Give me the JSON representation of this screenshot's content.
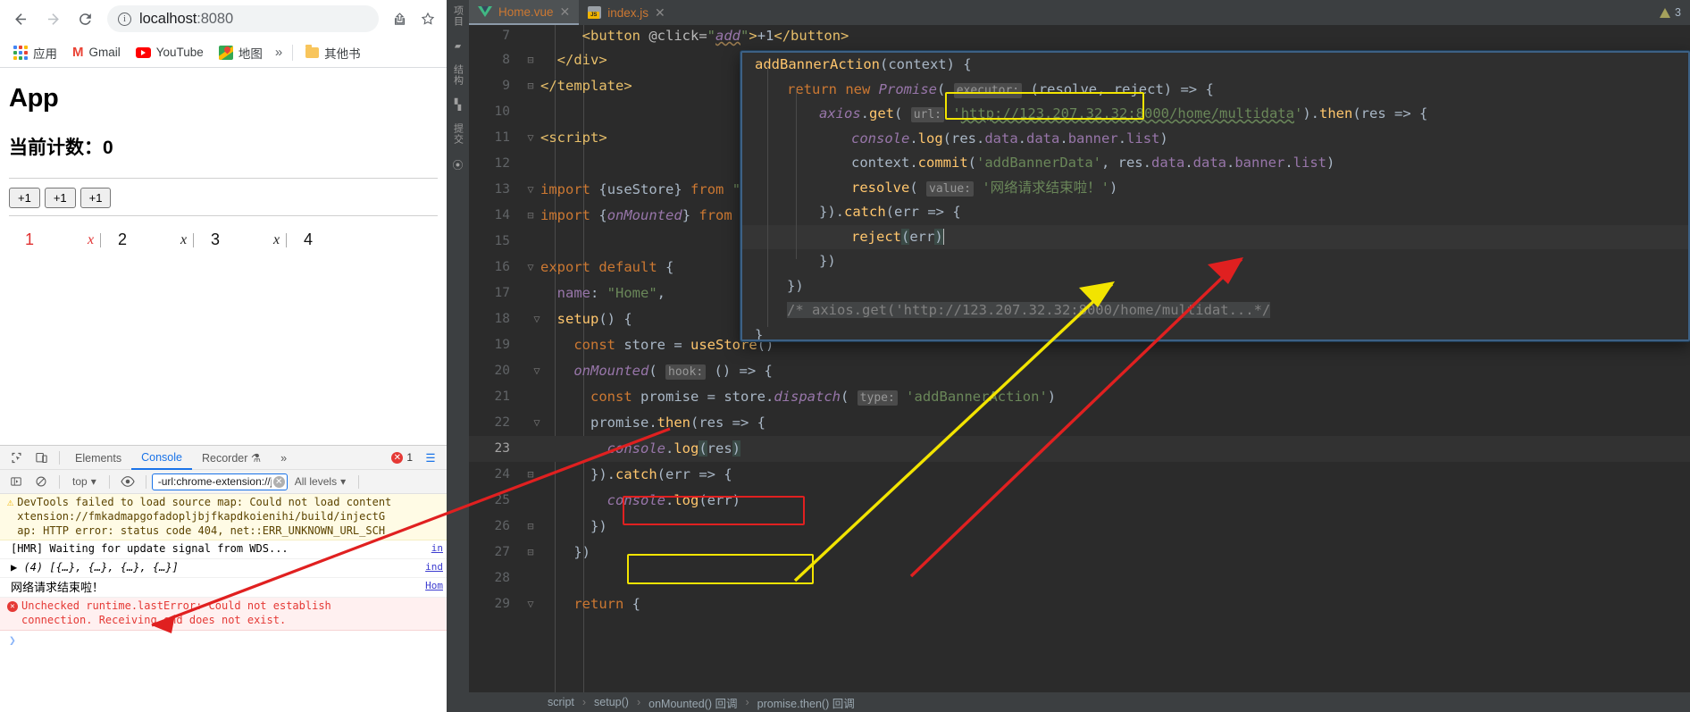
{
  "browser": {
    "nav": {
      "back": "←",
      "forward": "→",
      "reload": "⟳"
    },
    "omnibox": {
      "info_icon": "i",
      "url_host": "localhost",
      "url_port": ":8080",
      "share_icon": "share-icon",
      "star_icon": "★"
    },
    "bookmarks": [
      {
        "label": "应用",
        "icon": "apps-grid-icon"
      },
      {
        "label": "Gmail",
        "icon": "gmail-icon"
      },
      {
        "label": "YouTube",
        "icon": "youtube-icon"
      },
      {
        "label": "地图",
        "icon": "maps-icon"
      },
      {
        "label": "»",
        "icon": "overflow-icon"
      },
      {
        "label": "其他书",
        "icon": "folder-icon"
      }
    ],
    "page": {
      "title": "App",
      "counter_label": "当前计数：0",
      "buttons": [
        "+1",
        "+1",
        "+1"
      ],
      "numbers": [
        "1",
        "2",
        "3",
        "4"
      ],
      "x_label": "x"
    }
  },
  "devtools": {
    "tabs": [
      {
        "label": "Elements",
        "active": false
      },
      {
        "label": "Console",
        "active": true
      },
      {
        "label": "Recorder",
        "active": false,
        "suffix": "⚗"
      },
      {
        "label": "»",
        "active": false
      }
    ],
    "error_count": "1",
    "filterbar": {
      "context": "top",
      "filter_value": "-url:chrome-extension://j",
      "levels": "All levels"
    },
    "messages": [
      {
        "kind": "warning",
        "text": "DevTools failed to load source map: Could not load content\nxtension://fmkadmapgofadopljbjfkapdkoienihi/build/injectG\nap: HTTP error: status code 404, net::ERR_UNKNOWN_URL_SCH",
        "link": ""
      },
      {
        "kind": "info",
        "text": "[HMR] Waiting for update signal from WDS...",
        "link": "in"
      },
      {
        "kind": "info",
        "text": "▶ (4) [{…}, {…}, {…}, {…}]",
        "link": "ind"
      },
      {
        "kind": "info",
        "text": "网络请求结束啦！",
        "link": "Hom"
      },
      {
        "kind": "error",
        "text": "Unchecked runtime.lastError: Could not establish\nconnection. Receiving end does not exist.",
        "link": ""
      }
    ],
    "prompt": "❯"
  },
  "ide": {
    "left_strip": [
      {
        "label": "项目",
        "icon": "folder-icon"
      },
      {
        "label": "结构",
        "icon": "structure-icon"
      },
      {
        "label": "提交",
        "icon": "commit-icon"
      }
    ],
    "tabs": [
      {
        "label": "Home.vue",
        "icon": "vue-icon",
        "active": true
      },
      {
        "label": "index.js",
        "icon": "js-icon",
        "active": false
      }
    ],
    "warning_count": "3",
    "breadcrumb": [
      "script",
      "setup()",
      "onMounted() 回调",
      "promise.then() 回调"
    ],
    "editor_lines": [
      {
        "n": "7",
        "indent": 3,
        "text": "<button @click=\"add\">+1</button>"
      },
      {
        "n": "8",
        "indent": 2,
        "text": "</div>",
        "fold": "minus"
      },
      {
        "n": "9",
        "indent": 1,
        "text": "</template>",
        "fold": "minus"
      },
      {
        "n": "10",
        "indent": 0,
        "text": ""
      },
      {
        "n": "11",
        "indent": 1,
        "text": "<script>",
        "fold": "plus"
      },
      {
        "n": "12",
        "indent": 0,
        "text": ""
      },
      {
        "n": "13",
        "indent": 1,
        "text": "import {useStore} from \"vuex\";",
        "fold": "plus"
      },
      {
        "n": "14",
        "indent": 1,
        "text": "import {onMounted} from \"vue\";",
        "fold": "minus"
      },
      {
        "n": "15",
        "indent": 0,
        "text": ""
      },
      {
        "n": "16",
        "indent": 1,
        "text": "export default {",
        "fold": "plus"
      },
      {
        "n": "17",
        "indent": 2,
        "text": "name: \"Home\","
      },
      {
        "n": "18",
        "indent": 2,
        "text": "setup() {",
        "fold": "plus"
      },
      {
        "n": "19",
        "indent": 3,
        "text": "const store = useStore()"
      },
      {
        "n": "20",
        "indent": 3,
        "text": "onMounted( hook: () => {",
        "fold": "plus"
      },
      {
        "n": "21",
        "indent": 4,
        "text": "const promise = store.dispatch( type: 'addBannerAction')"
      },
      {
        "n": "22",
        "indent": 4,
        "text": "promise.then(res => {",
        "fold": "plus"
      },
      {
        "n": "23",
        "indent": 5,
        "text": "console.log(res)",
        "highlight": true
      },
      {
        "n": "24",
        "indent": 4,
        "text": "}).catch(err => {",
        "fold": "minus"
      },
      {
        "n": "25",
        "indent": 5,
        "text": "console.log(err)"
      },
      {
        "n": "26",
        "indent": 4,
        "text": "})",
        "fold": "minus"
      },
      {
        "n": "27",
        "indent": 3,
        "text": "})",
        "fold": "minus"
      },
      {
        "n": "28",
        "indent": 0,
        "text": ""
      },
      {
        "n": "29",
        "indent": 3,
        "text": "return {",
        "fold": "plus"
      }
    ],
    "popup_lines": [
      {
        "text": "addBannerAction(context) {"
      },
      {
        "text": "return new Promise( executor: (resolve, reject) => {"
      },
      {
        "text": "axios.get( url: 'http://123.207.32.32:8000/home/multidata').then(res => {"
      },
      {
        "text": "console.log(res.data.data.banner.list)"
      },
      {
        "text": "context.commit('addBannerData', res.data.data.banner.list)"
      },
      {
        "text": "resolve( value: '网络请求结束啦！')"
      },
      {
        "text": "}).catch(err => {"
      },
      {
        "text": "reject(err)",
        "highlight": true
      },
      {
        "text": "})"
      },
      {
        "text": "})"
      },
      {
        "text": "/* axios.get('http://123.207.32.32:8000/home/multidat...*/"
      },
      {
        "text": "}"
      }
    ]
  },
  "annotations": {
    "red_boxes": [
      "console.log(res)"
    ],
    "yellow_boxes": [
      "console.log(err)",
      "return new Promise"
    ],
    "colors": {
      "red": "#e02020",
      "yellow": "#f2e400",
      "accent_blue": "#1a73e8"
    }
  }
}
